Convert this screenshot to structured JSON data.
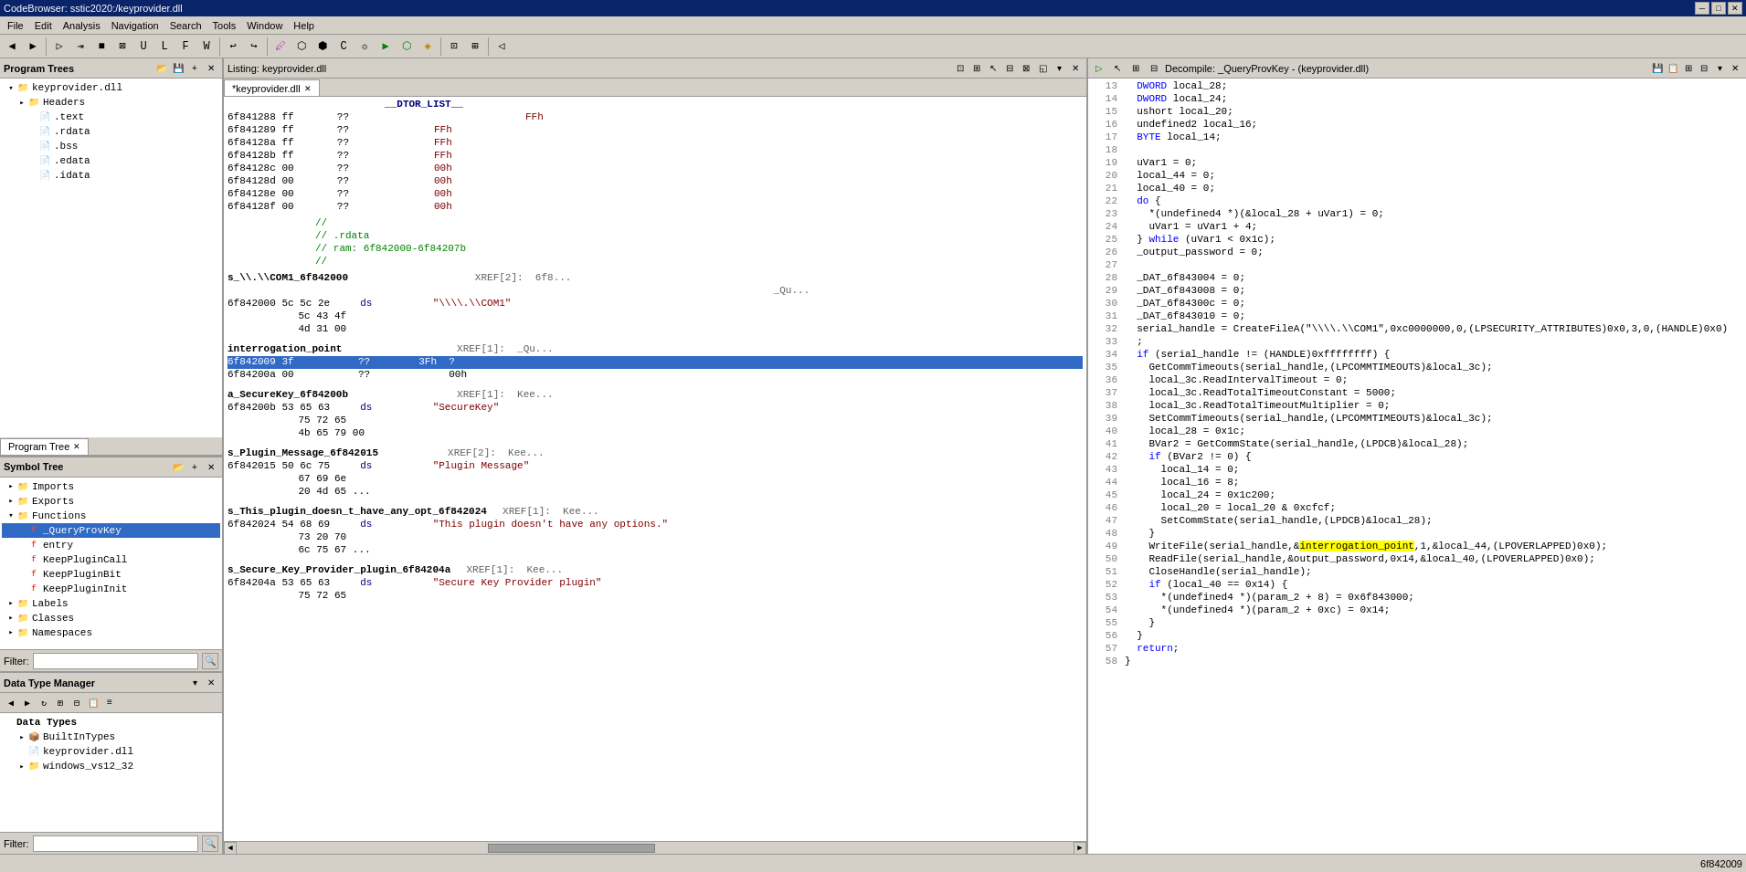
{
  "titleBar": {
    "title": "CodeBrowser: sstic2020:/keyprovider.dll",
    "minBtn": "─",
    "maxBtn": "□",
    "closeBtn": "✕"
  },
  "menuBar": {
    "items": [
      "File",
      "Edit",
      "Analysis",
      "Navigation",
      "Search",
      "Tools",
      "Window",
      "Help"
    ]
  },
  "leftPanel": {
    "programTree": {
      "title": "Program Trees",
      "tabLabel": "Program Tree",
      "root": "keyprovider.dll",
      "items": [
        {
          "label": "keyprovider.dll",
          "indent": 0,
          "type": "root",
          "expanded": true
        },
        {
          "label": "Headers",
          "indent": 1,
          "type": "folder"
        },
        {
          "label": ".text",
          "indent": 2,
          "type": "file"
        },
        {
          "label": ".rdata",
          "indent": 2,
          "type": "file"
        },
        {
          "label": ".bss",
          "indent": 2,
          "type": "file"
        },
        {
          "label": ".edata",
          "indent": 2,
          "type": "file"
        },
        {
          "label": ".idata",
          "indent": 2,
          "type": "file"
        }
      ]
    },
    "symbolTree": {
      "title": "Symbol Tree",
      "items": [
        {
          "label": "Imports",
          "indent": 0,
          "type": "folder",
          "expanded": false
        },
        {
          "label": "Exports",
          "indent": 0,
          "type": "folder",
          "expanded": false
        },
        {
          "label": "Functions",
          "indent": 0,
          "type": "folder",
          "expanded": true
        },
        {
          "label": "_QueryProvKey",
          "indent": 1,
          "type": "func",
          "selected": true
        },
        {
          "label": "entry",
          "indent": 1,
          "type": "func"
        },
        {
          "label": "KeepPluginCall",
          "indent": 1,
          "type": "func"
        },
        {
          "label": "KeepPluginBit",
          "indent": 1,
          "type": "func"
        },
        {
          "label": "KeepPluginInit",
          "indent": 1,
          "type": "func"
        },
        {
          "label": "Labels",
          "indent": 0,
          "type": "folder"
        },
        {
          "label": "Classes",
          "indent": 0,
          "type": "folder"
        },
        {
          "label": "Namespaces",
          "indent": 0,
          "type": "folder"
        }
      ]
    },
    "filter": {
      "label": "Filter:",
      "placeholder": ""
    },
    "dataTypeManager": {
      "title": "Data Type Manager",
      "types": [
        {
          "label": "BuiltInTypes",
          "indent": 1,
          "type": "folder"
        },
        {
          "label": "keyprovider.dll",
          "indent": 1,
          "type": "file"
        },
        {
          "label": "windows_vs12_32",
          "indent": 1,
          "type": "folder"
        }
      ]
    }
  },
  "listing": {
    "title": "Listing: keyprovider.dll",
    "tab": "*keyprovider.dll",
    "lines": [
      {
        "addr": "",
        "content": "          __DTOR_LIST__",
        "type": "label"
      },
      {
        "addr": "6f841288 ff",
        "bytes": "  ??",
        "val": "          FFh",
        "type": "data"
      },
      {
        "addr": "6f841289 ff",
        "bytes": "  ??",
        "val": "          FFh",
        "type": "data"
      },
      {
        "addr": "6f84128a ff",
        "bytes": "  ??",
        "val": "          FFh",
        "type": "data"
      },
      {
        "addr": "6f84128b ff",
        "bytes": "  ??",
        "val": "          FFh",
        "type": "data"
      },
      {
        "addr": "6f84128c 00",
        "bytes": "  ??",
        "val": "          00h",
        "type": "data"
      },
      {
        "addr": "6f84128d 00",
        "bytes": "  ??",
        "val": "          00h",
        "type": "data"
      },
      {
        "addr": "6f84128e 00",
        "bytes": "  ??",
        "val": "          00h",
        "type": "data"
      },
      {
        "addr": "6f84128f 00",
        "bytes": "  ??",
        "val": "          00h",
        "type": "data"
      },
      {
        "addr": "",
        "content": "          //",
        "type": "comment"
      },
      {
        "addr": "",
        "content": "          // .rdata",
        "type": "comment"
      },
      {
        "addr": "",
        "content": "          // ram: 6f842000-6f84207b",
        "type": "comment"
      },
      {
        "addr": "",
        "content": "          //",
        "type": "comment"
      },
      {
        "addr": "",
        "content": "s_\\\\.\\COM1_6f842000                  XREF[2]:  6f8...",
        "type": "xref"
      },
      {
        "addr": "",
        "content": "                                                  _Qu...",
        "type": "xref"
      },
      {
        "addr": "6f842000 5c 5c 2e",
        "bytes": "     ds",
        "val": "       \"\\\\\\\\.\\\\COM1\"",
        "type": "string"
      },
      {
        "addr": "         5c 43 4f",
        "bytes": "",
        "val": "",
        "type": "bytes"
      },
      {
        "addr": "         4d 31 00",
        "bytes": "",
        "val": "",
        "type": "bytes"
      },
      {
        "addr": "",
        "content": "",
        "type": "empty"
      },
      {
        "addr": "",
        "content": "interrogation_point                XREF[1]:  _Qu...",
        "type": "xref"
      },
      {
        "addr": "6f842009 3f",
        "bytes": "     ??",
        "val": "     3Fh  ?",
        "type": "data",
        "highlighted": true
      },
      {
        "addr": "6f84200a 00",
        "bytes": "     ??",
        "val": "          00h",
        "type": "data"
      },
      {
        "addr": "",
        "content": "",
        "type": "empty"
      },
      {
        "addr": "",
        "content": "a_SecureKey_6f84200b               XREF[1]:  Kee...",
        "type": "xref"
      },
      {
        "addr": "6f84200b 53 65 63",
        "bytes": "     ds",
        "val": "       \"SecureKey\"",
        "type": "string"
      },
      {
        "addr": "         75 72 65",
        "bytes": "",
        "val": "",
        "type": "bytes"
      },
      {
        "addr": "         4b 65 79 00",
        "bytes": "",
        "val": "",
        "type": "bytes"
      },
      {
        "addr": "",
        "content": "",
        "type": "empty"
      },
      {
        "addr": "",
        "content": "s_Plugin_Message_6f842015          XREF[2]:  Kee...",
        "type": "xref"
      },
      {
        "addr": "6f842015 50 6c 75",
        "bytes": "     ds",
        "val": "       \"Plugin Message\"",
        "type": "string"
      },
      {
        "addr": "         67 69 6e",
        "bytes": "",
        "val": "",
        "type": "bytes"
      },
      {
        "addr": "         20 4d 65 ...",
        "bytes": "",
        "val": "",
        "type": "bytes"
      },
      {
        "addr": "",
        "content": "",
        "type": "empty"
      },
      {
        "addr": "",
        "content": "s_This_plugin_doesn_t_have_any_opt_6f842024  XREF[1]:  Kee...",
        "type": "xref"
      },
      {
        "addr": "6f842024 54 68 69",
        "bytes": "     ds",
        "val": "       \"This plugin doesn't have any options.\"",
        "type": "string"
      },
      {
        "addr": "         73 20 70",
        "bytes": "",
        "val": "",
        "type": "bytes"
      },
      {
        "addr": "         6c 75 67 ...",
        "bytes": "",
        "val": "",
        "type": "bytes"
      },
      {
        "addr": "",
        "content": "",
        "type": "empty"
      },
      {
        "addr": "",
        "content": "s_Secure_Key_Provider_plugin_6f84204a  XREF[1]:  Kee...",
        "type": "xref"
      },
      {
        "addr": "6f84204a 53 65 63",
        "bytes": "     ds",
        "val": "       \"Secure Key Provider plugin\"",
        "type": "string"
      },
      {
        "addr": "         75 72 65",
        "bytes": "",
        "val": "",
        "type": "bytes"
      }
    ]
  },
  "decompiler": {
    "title": "Decompile: _QueryProvKey - (keyprovider.dll)",
    "lines": [
      {
        "num": 13,
        "text": "  DWORD local_28;"
      },
      {
        "num": 14,
        "text": "  DWORD local_24;"
      },
      {
        "num": 15,
        "text": "  ushort local_20;"
      },
      {
        "num": 16,
        "text": "  undefined2 local_16;"
      },
      {
        "num": 17,
        "text": "  BYTE local_14;"
      },
      {
        "num": 18,
        "text": ""
      },
      {
        "num": 19,
        "text": "  uVar1 = 0;"
      },
      {
        "num": 20,
        "text": "  local_44 = 0;"
      },
      {
        "num": 21,
        "text": "  local_40 = 0;"
      },
      {
        "num": 22,
        "text": "  do {"
      },
      {
        "num": 23,
        "text": "    *(undefined4 *)(&local_28 + uVar1) = 0;"
      },
      {
        "num": 24,
        "text": "    uVar1 = uVar1 + 4;"
      },
      {
        "num": 25,
        "text": "  } while (uVar1 < 0x1c);"
      },
      {
        "num": 26,
        "text": "  _output_password = 0;"
      },
      {
        "num": 27,
        "text": ""
      },
      {
        "num": 28,
        "text": "  _DAT_6f843004 = 0;"
      },
      {
        "num": 29,
        "text": "  _DAT_6f843008 = 0;"
      },
      {
        "num": 30,
        "text": "  _DAT_6f84300c = 0;"
      },
      {
        "num": 31,
        "text": "  _DAT_6f843010 = 0;"
      },
      {
        "num": 32,
        "text": "  serial_handle = CreateFileA(\"\\\\\\\\.\\\\COM1\",0xc0000000,0,(LPSECURITY_ATTRIBUTES)0x0,3,0,(HANDLE)0x0)"
      },
      {
        "num": 33,
        "text": "  ;"
      },
      {
        "num": 34,
        "text": "  if (serial_handle != (HANDLE)0xffffffff) {"
      },
      {
        "num": 35,
        "text": "    GetCommTimeouts(serial_handle,(LPCOMMTIMEOUTS)&local_3c);"
      },
      {
        "num": 36,
        "text": "    local_3c.ReadIntervalTimeout = 0;"
      },
      {
        "num": 37,
        "text": "    local_3c.ReadTotalTimeoutConstant = 5000;"
      },
      {
        "num": 38,
        "text": "    local_3c.ReadTotalTimeoutMultiplier = 0;"
      },
      {
        "num": 39,
        "text": "    SetCommTimeouts(serial_handle,(LPCOMMTIMEOUTS)&local_3c);"
      },
      {
        "num": 40,
        "text": "    local_28 = 0x1c;"
      },
      {
        "num": 41,
        "text": "    BVar2 = GetCommState(serial_handle,(LPDCB)&local_28);"
      },
      {
        "num": 42,
        "text": "    if (BVar2 != 0) {"
      },
      {
        "num": 43,
        "text": "      local_14 = 0;"
      },
      {
        "num": 44,
        "text": "      local_16 = 8;"
      },
      {
        "num": 45,
        "text": "      local_24 = 0x1c200;"
      },
      {
        "num": 46,
        "text": "      local_20 = local_20 & 0xcfcf;"
      },
      {
        "num": 47,
        "text": "      SetCommState(serial_handle,(LPDCB)&local_28);"
      },
      {
        "num": 48,
        "text": "    }"
      },
      {
        "num": 49,
        "text": "    WriteFile(serial_handle,&interrogation_point,1,&local_44,(LPOVERLAPPED)0x0);"
      },
      {
        "num": 50,
        "text": "    ReadFile(serial_handle,&output_password,0x14,&local_40,(LPOVERLAPPED)0x0);"
      },
      {
        "num": 51,
        "text": "    CloseHandle(serial_handle);"
      },
      {
        "num": 52,
        "text": "    if (local_40 == 0x14) {"
      },
      {
        "num": 53,
        "text": "      *(undefined4 *)(param_2 + 8) = 0x6f843000;"
      },
      {
        "num": 54,
        "text": "      *(undefined4 *)(param_2 + 0xc) = 0x14;"
      },
      {
        "num": 55,
        "text": "    }"
      },
      {
        "num": 56,
        "text": "  }"
      },
      {
        "num": 57,
        "text": "  return;"
      },
      {
        "num": 58,
        "text": "}"
      }
    ],
    "highlightedVar": "interrogation_point"
  },
  "statusBar": {
    "left": "",
    "right": "6f842009"
  }
}
